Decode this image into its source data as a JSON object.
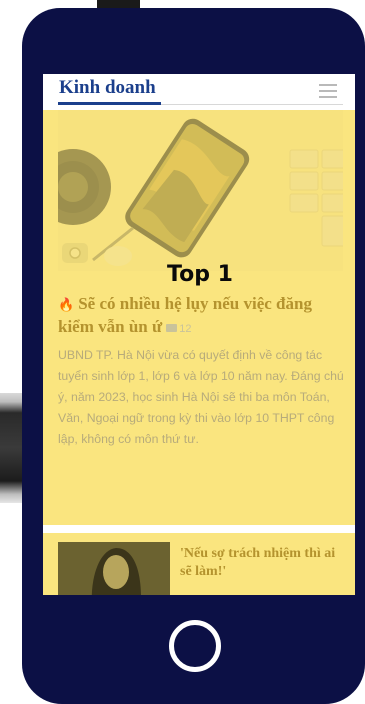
{
  "header": {
    "section_title": "Kinh doanh",
    "menu_icon": "hamburger-menu-icon"
  },
  "top_story": {
    "rank_label": "Top 1",
    "trending_icon": "flame-icon",
    "headline": "Sẽ có nhiều hệ lụy nếu việc đăng kiểm vẫn ùn ứ",
    "comment_icon": "comment-icon",
    "comment_count": "12",
    "summary": "UBND TP. Hà Nội vừa có quyết định về công tác tuyển sinh lớp 1, lớp 6 và lớp 10 năm nay. Đáng chú ý, năm 2023, học sinh Hà Nội sẽ thi ba môn Toán, Văn, Ngoại ngữ trong kỳ thi vào lớp 10 THPT công lập, không có môn thứ tư."
  },
  "related_story": {
    "title": "'Nếu sợ trách nhiệm thì ai sẽ làm!'",
    "media_icon": "video-camera-icon"
  },
  "colors": {
    "phone_frame": "#0c1045",
    "highlight": "#fae57f",
    "brand": "#1b3f8c",
    "headline": "#b4932e",
    "summary": "#b7ab7b"
  }
}
